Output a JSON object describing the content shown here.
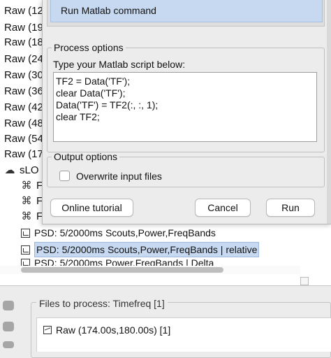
{
  "tree": {
    "raw_rows": [
      "Raw (12",
      "Raw (19",
      "Raw (18",
      "Raw (24",
      "Raw (30",
      "Raw (36",
      "Raw (42",
      "Raw (48",
      "Raw (54",
      "Raw (17"
    ],
    "slor_label": "sLO",
    "node_rows": [
      "F",
      "F",
      "F"
    ],
    "psd_rows": [
      {
        "label": "PSD: 5/2000ms Scouts,Power,FreqBands",
        "selected": false
      },
      {
        "label": "PSD: 5/2000ms Scouts,Power,FreqBands | relative",
        "selected": true
      },
      {
        "label": "PSD: 5/2000ms Power,FreqBands | Delta",
        "selected": false
      }
    ]
  },
  "dialog": {
    "selected_process": "Run Matlab command",
    "process_options_legend": "Process options",
    "script_label": "Type your Matlab script below:",
    "script_text": "TF2 = Data('TF');\nclear Data('TF');\nData('TF') = TF2(:, :, 1);\nclear TF2;",
    "output_options_legend": "Output options",
    "overwrite_label": "Overwrite input files",
    "overwrite_checked": false,
    "buttons": {
      "online_tutorial": "Online tutorial",
      "cancel": "Cancel",
      "run": "Run"
    }
  },
  "files_panel": {
    "label": "Files to process: Timefreq [1]",
    "items": [
      "Raw (174.00s,180.00s) [1]"
    ]
  },
  "colors": {
    "selection": "#c7d9f1",
    "panel": "#ececec"
  }
}
